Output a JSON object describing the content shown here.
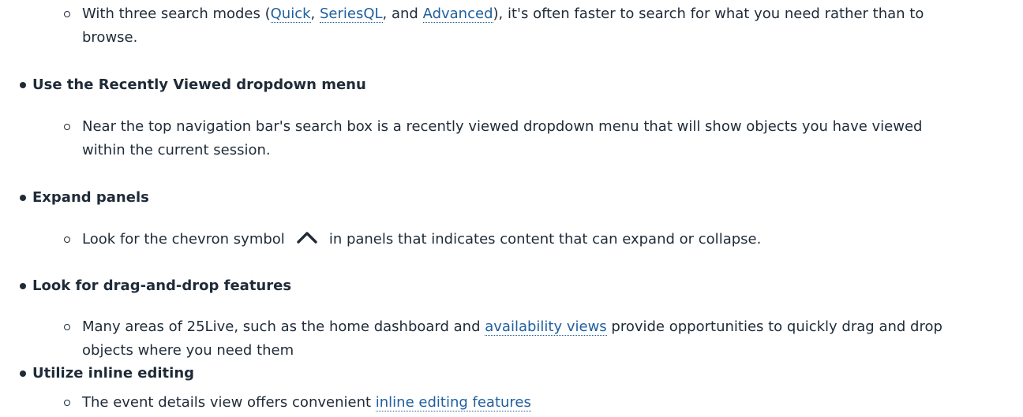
{
  "items": {
    "search": {
      "prefix": "With three search modes (",
      "quick": "Quick",
      "sep1": ", ",
      "seriesql": "SeriesQL",
      "sep2": ", and ",
      "advanced": "Advanced",
      "suffix": "), it's often faster to search for what you need rather than to browse."
    },
    "recently_viewed": {
      "title": "Use the Recently Viewed dropdown menu",
      "description": "Near the top navigation bar's search box is a recently viewed dropdown menu that will show objects you have viewed within the current session."
    },
    "expand_panels": {
      "title": "Expand panels",
      "before_icon": "Look for the chevron symbol",
      "icon": "chevron-up-icon",
      "after_icon": "in panels that indicates content that can expand or collapse."
    },
    "drag_drop": {
      "title": "Look for drag-and-drop features",
      "before_link": "Many areas of 25Live, such as the home dashboard and ",
      "link": "availability views",
      "after_link": " provide opportunities to quickly drag and drop objects where you need them"
    },
    "inline_editing": {
      "title": "Utilize inline editing",
      "before_link": "The event details view offers convenient ",
      "link": "inline editing features"
    }
  }
}
